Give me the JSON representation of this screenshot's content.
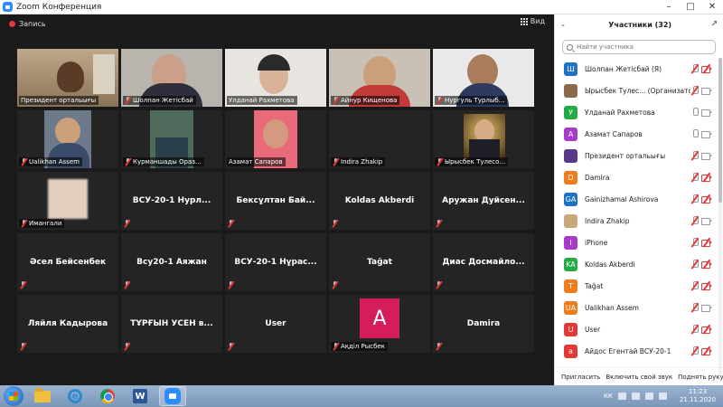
{
  "window": {
    "title": "Zoom Конференция"
  },
  "toolbar": {
    "recording_label": "Запись",
    "view_label": "Вид"
  },
  "tiles": [
    {
      "name": "Президент ортальығы"
    },
    {
      "name": "Шолпан Жетісбай"
    },
    {
      "name": "Улданай Рахметова"
    },
    {
      "name": "Айнур Кищенова"
    },
    {
      "name": "Нургуль Турлыб..."
    },
    {
      "name": "Ualikhan Assem"
    },
    {
      "name": "Курманшады Ораз..."
    },
    {
      "name": "Азамат Сапаров"
    },
    {
      "name": "Indira Zhakip"
    },
    {
      "name": "Ырысбек Тулесо..."
    },
    {
      "name": "Имангали"
    },
    {
      "name": "ВСУ-20-1  Нурл..."
    },
    {
      "name": "Бексұлтан Бай..."
    },
    {
      "name": "Koldas Akberdi"
    },
    {
      "name": "Аружан  Дуйсен..."
    },
    {
      "name": "Әсел Бейсенбек"
    },
    {
      "name": "Всу20-1 Аяжан"
    },
    {
      "name": "ВСУ-20-1 Нұрас..."
    },
    {
      "name": "Tağat"
    },
    {
      "name": "Диас Досмайло..."
    },
    {
      "name": "Ляйля Кадырова"
    },
    {
      "name": "ТҰРҒЫН УСЕН в..."
    },
    {
      "name": "User"
    },
    {
      "name": "Ақділ Рысбек",
      "avatar_letter": "A"
    },
    {
      "name": "Damira"
    }
  ],
  "participants": {
    "title": "Участники (32)",
    "search_placeholder": "Найти участника",
    "list": [
      {
        "initials": "Ш",
        "color": "#1e72c8",
        "name": "Шолпан Жетісбай (Я)",
        "mic_muted": true,
        "cam_off": true
      },
      {
        "initials": "",
        "color": "#8a6a4a",
        "name": "Ырысбек Тулес...  (Организатор)",
        "mic_muted": true,
        "cam_off": false
      },
      {
        "initials": "У",
        "color": "#22aa44",
        "name": "Улданай Рахметова",
        "mic_muted": false,
        "cam_off": false
      },
      {
        "initials": "А",
        "color": "#a63cc7",
        "name": "Азамат Сапаров",
        "mic_muted": false,
        "cam_off": false
      },
      {
        "initials": "",
        "color": "#5a3a8a",
        "name": "Президент ортальығы",
        "mic_muted": true,
        "cam_off": false
      },
      {
        "initials": "D",
        "color": "#f07c1b",
        "name": "Damira",
        "mic_muted": true,
        "cam_off": true
      },
      {
        "initials": "GA",
        "color": "#1e72c8",
        "name": "Gainizhamal Ashirova",
        "mic_muted": true,
        "cam_off": true
      },
      {
        "initials": "",
        "color": "#c8a878",
        "name": "Indira Zhakip",
        "mic_muted": true,
        "cam_off": false
      },
      {
        "initials": "I",
        "color": "#a63cc7",
        "name": "iPhone",
        "mic_muted": true,
        "cam_off": true
      },
      {
        "initials": "KA",
        "color": "#22aa44",
        "name": "Koldas Akberdi",
        "mic_muted": true,
        "cam_off": true
      },
      {
        "initials": "T",
        "color": "#f07c1b",
        "name": "Tağat",
        "mic_muted": true,
        "cam_off": true
      },
      {
        "initials": "UA",
        "color": "#f07c1b",
        "name": "Ualikhan Assem",
        "mic_muted": true,
        "cam_off": false
      },
      {
        "initials": "U",
        "color": "#e53935",
        "name": "User",
        "mic_muted": true,
        "cam_off": true
      },
      {
        "initials": "a",
        "color": "#e53935",
        "name": "Айдос Егентай ВСУ-20-1",
        "mic_muted": true,
        "cam_off": true
      }
    ],
    "footer": {
      "invite": "Пригласить",
      "unmute": "Включить свой звук",
      "raise_hand": "Поднять руку"
    }
  },
  "taskbar": {
    "lang": "КК",
    "time": "11:23",
    "date": "21.11.2020"
  }
}
